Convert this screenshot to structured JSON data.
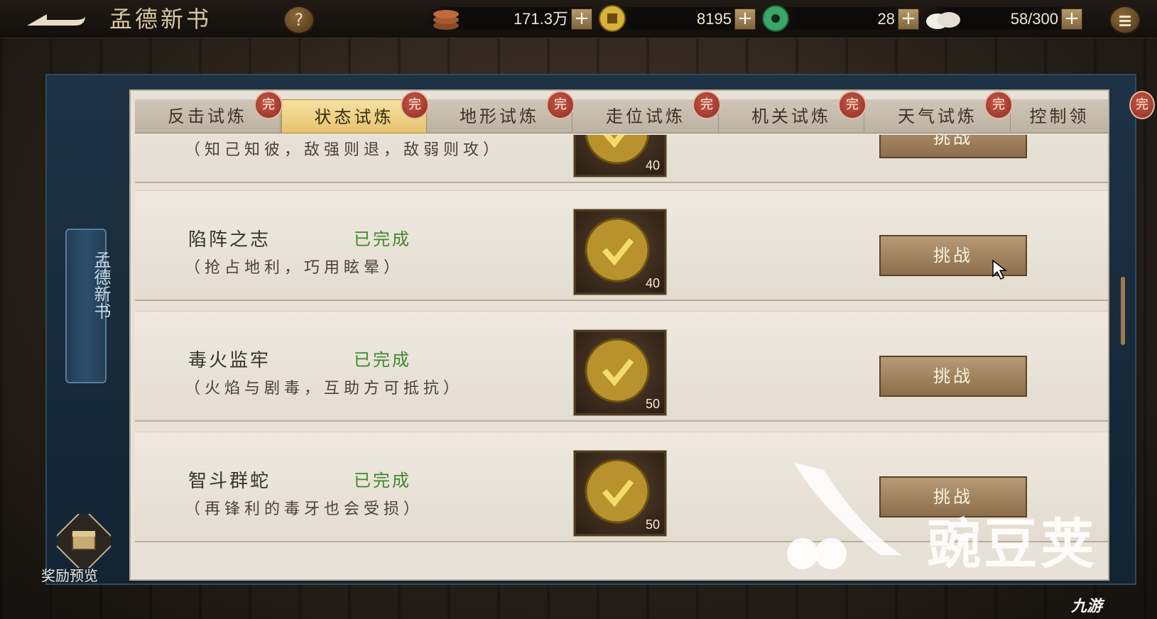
{
  "header": {
    "title": "孟德新书",
    "help_label": "?",
    "resources": [
      {
        "name": "coins",
        "icon": "copper-coins-icon",
        "value": "171.3万"
      },
      {
        "name": "gold",
        "icon": "gold-coin-icon",
        "value": "8195"
      },
      {
        "name": "jade",
        "icon": "jade-disc-icon",
        "value": "28"
      },
      {
        "name": "stamina",
        "icon": "bun-icon",
        "value": "58/300"
      }
    ],
    "plus_label": "+"
  },
  "sidebar": {
    "banner_label": "孟德新书",
    "reward_preview_label": "奖励预览"
  },
  "tabs": [
    {
      "label": "反击试炼",
      "badge": "完",
      "active": false
    },
    {
      "label": "状态试炼",
      "badge": "完",
      "active": true
    },
    {
      "label": "地形试炼",
      "badge": "完",
      "active": false
    },
    {
      "label": "走位试炼",
      "badge": "完",
      "active": false
    },
    {
      "label": "机关试炼",
      "badge": "完",
      "active": false
    },
    {
      "label": "天气试炼",
      "badge": "完",
      "active": false
    },
    {
      "label": "控制领",
      "badge": "完",
      "active": false
    }
  ],
  "rows": [
    {
      "name": "",
      "status": "",
      "desc": "（知己知彼，敌强则退，敌弱则攻）",
      "reward_count": "40",
      "button": "挑战"
    },
    {
      "name": "陷阵之志",
      "status": "已完成",
      "desc": "（抢占地利，巧用眩晕）",
      "reward_count": "40",
      "button": "挑战"
    },
    {
      "name": "毒火监牢",
      "status": "已完成",
      "desc": "（火焰与剧毒，互助方可抵抗）",
      "reward_count": "50",
      "button": "挑战"
    },
    {
      "name": "智斗群蛇",
      "status": "已完成",
      "desc": "（再锋利的毒牙也会受损）",
      "reward_count": "50",
      "button": "挑战"
    }
  ],
  "watermark": {
    "text": "豌豆荚",
    "corner_logo": "九游"
  },
  "colors": {
    "status_done": "#3f8a2a",
    "tab_active": "#e6c370",
    "badge": "#8c2c22"
  }
}
